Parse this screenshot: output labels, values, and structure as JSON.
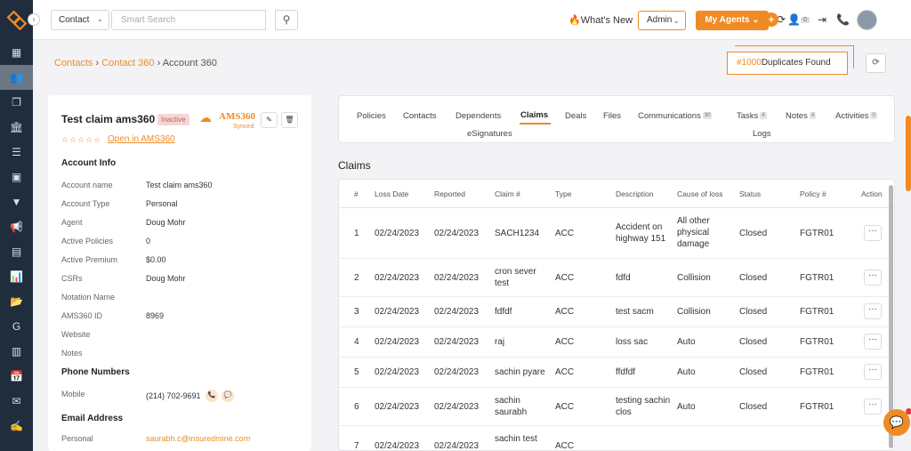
{
  "topbar": {
    "contact_select": "Contact",
    "search_placeholder": "Smart Search",
    "whats_new": "What's New",
    "admin_select": "Admin",
    "my_agents": "My Agents",
    "notif_count": "0"
  },
  "breadcrumb": {
    "crumb1": "Contacts",
    "crumb2": "Contact 360",
    "crumb3": "Account 360"
  },
  "duplicates": {
    "count": "#1000",
    "label": "Duplicates Found"
  },
  "account": {
    "name": "Test claim ams360",
    "status": "Inactive",
    "logo_text": "AMS360",
    "synced": "Synced",
    "stars": "☆☆☆☆☆",
    "open_in": "Open in AMS360",
    "section_info": "Account Info",
    "fields": [
      {
        "label": "Account name",
        "value": "Test claim ams360"
      },
      {
        "label": "Account Type",
        "value": "Personal"
      },
      {
        "label": "Agent",
        "value": "Doug Mohr"
      },
      {
        "label": "Active Policies",
        "value": "0"
      },
      {
        "label": "Active Premium",
        "value": "$0.00"
      },
      {
        "label": "CSRs",
        "value": "Doug Mohr"
      },
      {
        "label": "Notation Name",
        "value": ""
      },
      {
        "label": "AMS360 ID",
        "value": "8969"
      },
      {
        "label": "Website",
        "value": ""
      },
      {
        "label": "Notes",
        "value": ""
      }
    ],
    "section_phone": "Phone Numbers",
    "phone_label": "Mobile",
    "phone_value": "(214) 702-9691",
    "section_email": "Email Address",
    "email_label": "Personal",
    "email_value": "saurabh.c@insuredmine.com"
  },
  "tabs": [
    {
      "label": "Policies"
    },
    {
      "label": "Contacts"
    },
    {
      "label": "Dependents"
    },
    {
      "label": "Claims"
    },
    {
      "label": "Deals"
    },
    {
      "label": "Files"
    },
    {
      "label": "Communications",
      "count": "30"
    },
    {
      "label": "Tasks",
      "count": "4"
    },
    {
      "label": "Notes",
      "count": "4"
    },
    {
      "label": "Activities",
      "count": "0"
    },
    {
      "label": "eSignatures"
    },
    {
      "label": "Logs"
    }
  ],
  "claims": {
    "title": "Claims",
    "columns": [
      "#",
      "Loss Date",
      "Reported",
      "Claim #",
      "Type",
      "Description",
      "Cause of loss",
      "Status",
      "Policy #",
      "Action"
    ],
    "rows": [
      {
        "num": "1",
        "loss": "02/24/2023",
        "reported": "02/24/2023",
        "claim": "SACH1234",
        "type": "ACC",
        "desc": "Accident on highway 151",
        "cause": "All other physical damage",
        "status": "Closed",
        "policy": "FGTR01"
      },
      {
        "num": "2",
        "loss": "02/24/2023",
        "reported": "02/24/2023",
        "claim": "cron sever test",
        "type": "ACC",
        "desc": "fdfd",
        "cause": "Collision",
        "status": "Closed",
        "policy": "FGTR01"
      },
      {
        "num": "3",
        "loss": "02/24/2023",
        "reported": "02/24/2023",
        "claim": "fdfdf",
        "type": "ACC",
        "desc": "test sacm",
        "cause": "Collision",
        "status": "Closed",
        "policy": "FGTR01"
      },
      {
        "num": "4",
        "loss": "02/24/2023",
        "reported": "02/24/2023",
        "claim": "raj",
        "type": "ACC",
        "desc": "loss sac",
        "cause": "Auto",
        "status": "Closed",
        "policy": "FGTR01"
      },
      {
        "num": "5",
        "loss": "02/24/2023",
        "reported": "02/24/2023",
        "claim": "sachin pyare",
        "type": "ACC",
        "desc": "ffdfdf",
        "cause": "Auto",
        "status": "Closed",
        "policy": "FGTR01"
      },
      {
        "num": "6",
        "loss": "02/24/2023",
        "reported": "02/24/2023",
        "claim": "sachin saurabh",
        "type": "ACC",
        "desc": "testing sachin clos",
        "cause": "Auto",
        "status": "Closed",
        "policy": "FGTR01"
      },
      {
        "num": "7",
        "loss": "02/24/2023",
        "reported": "02/24/2023",
        "claim": "sachin test",
        "type": "ACC",
        "desc": "",
        "cause": "",
        "status": "",
        "policy": ""
      }
    ]
  }
}
